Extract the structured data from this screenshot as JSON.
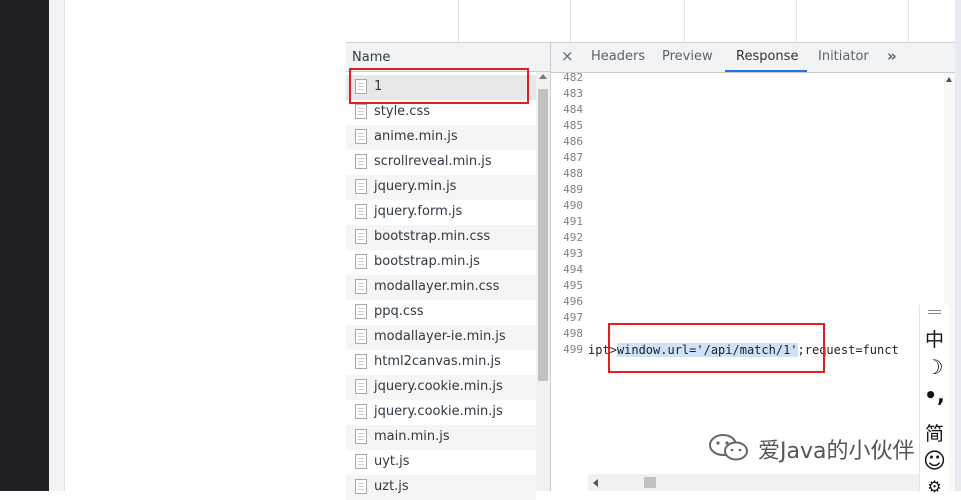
{
  "network": {
    "header": {
      "name_column": "Name"
    },
    "requests": [
      {
        "name": "1"
      },
      {
        "name": "style.css"
      },
      {
        "name": "anime.min.js"
      },
      {
        "name": "scrollreveal.min.js"
      },
      {
        "name": "jquery.min.js"
      },
      {
        "name": "jquery.form.js"
      },
      {
        "name": "bootstrap.min.css"
      },
      {
        "name": "bootstrap.min.js"
      },
      {
        "name": "modallayer.min.css"
      },
      {
        "name": "ppq.css"
      },
      {
        "name": "modallayer-ie.min.js"
      },
      {
        "name": "html2canvas.min.js"
      },
      {
        "name": "jquery.cookie.min.js"
      },
      {
        "name": "jquery.cookie.min.js"
      },
      {
        "name": "main.min.js"
      },
      {
        "name": "uyt.js"
      },
      {
        "name": "uzt.js"
      }
    ]
  },
  "response": {
    "tabs": {
      "close": "×",
      "headers": "Headers",
      "preview": "Preview",
      "response": "Response",
      "initiator": "Initiator",
      "more": "»"
    },
    "active_tab": "Response",
    "line_numbers": [
      "482",
      "483",
      "484",
      "485",
      "486",
      "487",
      "488",
      "489",
      "490",
      "491",
      "492",
      "493",
      "494",
      "495",
      "496",
      "497",
      "498",
      "499"
    ],
    "code": {
      "prefix": "ipt>",
      "highlight": "window.url='/api/match/1'",
      "suffix": ";request=funct"
    }
  },
  "ime": {
    "lang": "中",
    "moon": "☽",
    "punct": "•,",
    "simplified": "简",
    "emoji": "☺",
    "settings": "⚙"
  },
  "watermark": {
    "text": "爱Java的小伙伴",
    "icon": "wechat-icon"
  },
  "colors": {
    "annotation": "#e02020",
    "active_tab": "#1a73e8",
    "highlight": "#cfe1f7"
  }
}
